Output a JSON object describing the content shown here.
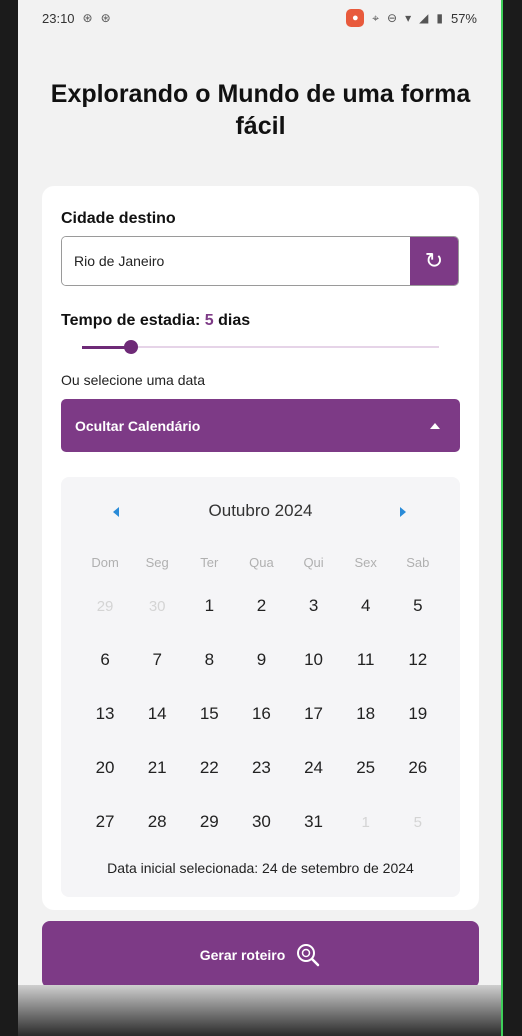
{
  "status": {
    "time": "23:10",
    "battery": "57%"
  },
  "title": "Explorando o Mundo de uma forma fácil",
  "city": {
    "label": "Cidade destino",
    "value": "Rio de Janeiro"
  },
  "stay": {
    "label": "Tempo de estadia:",
    "days": "5",
    "unit": "dias"
  },
  "or_select": "Ou selecione uma data",
  "toggle_label": "Ocultar Calendário",
  "calendar": {
    "month_label": "Outubro 2024",
    "weekdays": [
      "Dom",
      "Seg",
      "Ter",
      "Qua",
      "Qui",
      "Sex",
      "Sab"
    ],
    "weeks": [
      [
        "29",
        "30",
        "1",
        "2",
        "3",
        "4",
        "5"
      ],
      [
        "6",
        "7",
        "8",
        "9",
        "10",
        "11",
        "12"
      ],
      [
        "13",
        "14",
        "15",
        "16",
        "17",
        "18",
        "19"
      ],
      [
        "20",
        "21",
        "22",
        "23",
        "24",
        "25",
        "26"
      ],
      [
        "27",
        "28",
        "29",
        "30",
        "31",
        "1",
        "5"
      ]
    ],
    "muted": [
      [
        0,
        0
      ],
      [
        0,
        1
      ],
      [
        4,
        5
      ],
      [
        4,
        6
      ]
    ],
    "selected_info": "Data inicial selecionada: 24 de setembro de 2024"
  },
  "generate_label": "Gerar roteiro",
  "colors": {
    "accent": "#7d3a86",
    "nav_arrow": "#2a8bd8"
  }
}
